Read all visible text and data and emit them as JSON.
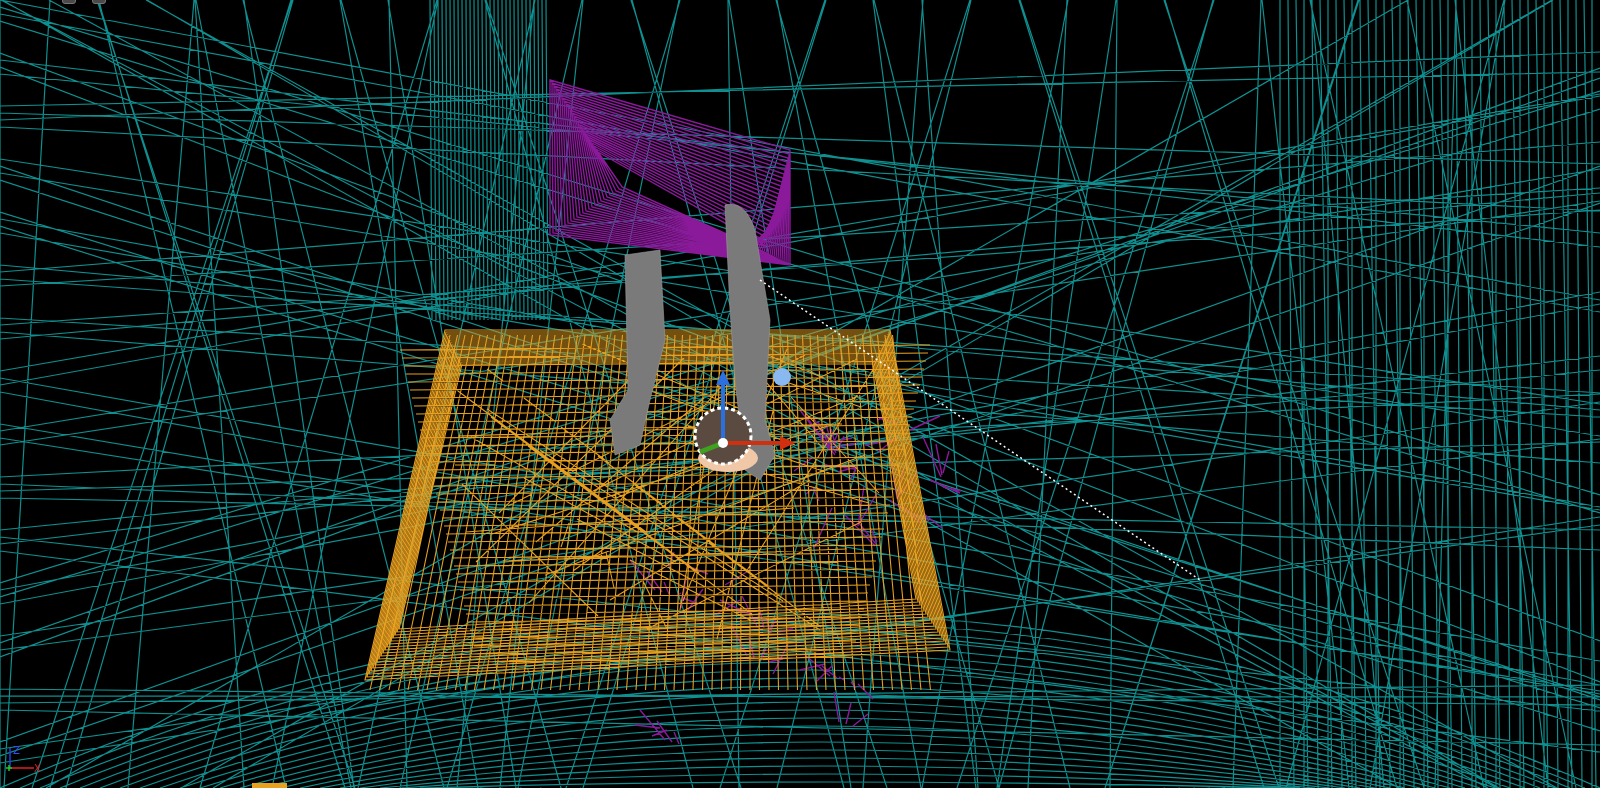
{
  "viewport": {
    "axis_gizmo": {
      "labels": [
        "Z",
        "X"
      ]
    }
  }
}
